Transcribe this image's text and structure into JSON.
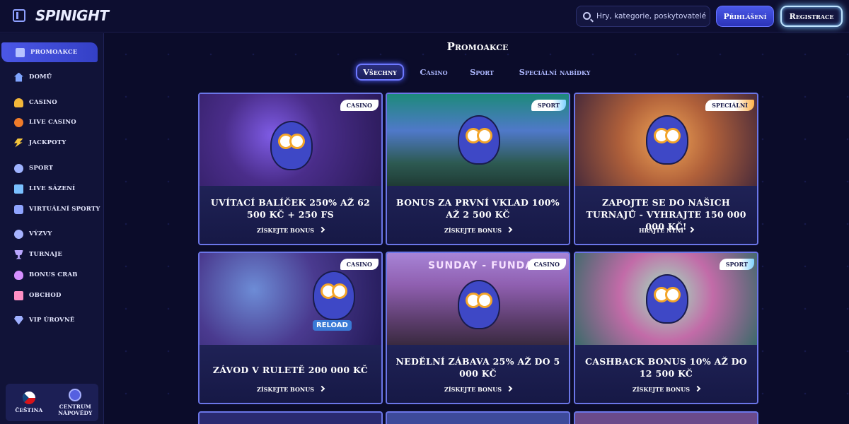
{
  "header": {
    "logo_text": "SPINIGHT",
    "search_placeholder": "Hry, kategorie, poskytovatelé",
    "login_label": "Přihlášení",
    "register_label": "Registrace"
  },
  "sidebar": {
    "items": [
      {
        "label": "Promoakce",
        "icon": "gift-icon",
        "active": true
      },
      {
        "label": "Domů",
        "icon": "home-icon"
      },
      {
        "label": "Casino",
        "icon": "casino-icon"
      },
      {
        "label": "Live casino",
        "icon": "live-casino-icon"
      },
      {
        "label": "Jackpoty",
        "icon": "jackpot-icon"
      },
      {
        "label": "Sport",
        "icon": "sport-icon"
      },
      {
        "label": "Live sázení",
        "icon": "live-betting-icon"
      },
      {
        "label": "Virtuální sporty",
        "icon": "virtual-sports-icon"
      },
      {
        "label": "Výzvy",
        "icon": "challenges-icon"
      },
      {
        "label": "Turnaje",
        "icon": "trophy-icon"
      },
      {
        "label": "Bonus crab",
        "icon": "crab-icon"
      },
      {
        "label": "Obchod",
        "icon": "shop-icon"
      },
      {
        "label": "VIP úrovně",
        "icon": "diamond-icon"
      }
    ],
    "language_label": "Čeština",
    "help_label_line1": "Centrum",
    "help_label_line2": "nápovědy"
  },
  "main": {
    "title": "Promoakce",
    "tabs": [
      {
        "label": "Všechny",
        "active": true
      },
      {
        "label": "Casino"
      },
      {
        "label": "Sport"
      },
      {
        "label": "Speciální nabídky"
      }
    ],
    "cards": [
      {
        "badge": "Casino",
        "title": "Uvítací balíček 250% až 62 500 Kč + 250 FS",
        "cta": "Získejte bonus"
      },
      {
        "badge": "Sport",
        "title": "Bonus za první vklad 100% až 2 500 Kč",
        "cta": "Získejte bonus"
      },
      {
        "badge": "Speciální",
        "title": "Zapojte se do našich turnajů - vyhrajte 150 000 000 Kč!",
        "cta": "Hrajte nyní"
      },
      {
        "badge": "Casino",
        "title": "Závod v ruletě 200 000 Kč",
        "cta": "Získejte bonus",
        "image_text": "RELOAD"
      },
      {
        "badge": "Casino",
        "title": "Nedělní zábava 25% až do 5 000 Kč",
        "cta": "Získejte bonus",
        "image_text": "SUNDAY - FUNDAY"
      },
      {
        "badge": "Sport",
        "title": "Cashback bonus 10% až do 12 500 Kč",
        "cta": "Získejte bonus"
      }
    ]
  },
  "colors": {
    "background": "#0b0c2a",
    "accent": "#4b57e6",
    "card_border": "#6b76e8"
  }
}
